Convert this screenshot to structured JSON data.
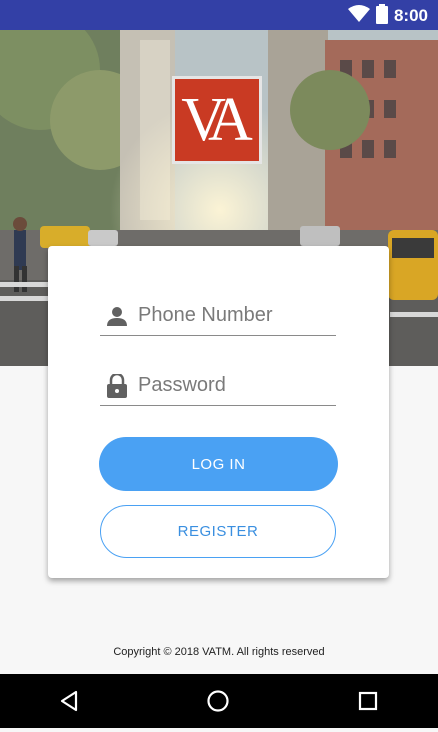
{
  "status_bar": {
    "time": "8:00",
    "icons": [
      "wifi-icon",
      "battery-icon"
    ]
  },
  "logo": {
    "text": "VA",
    "color": "#c93a23"
  },
  "form": {
    "phone": {
      "placeholder": "Phone Number",
      "value": "",
      "icon": "person-icon"
    },
    "password": {
      "placeholder": "Password",
      "value": "",
      "icon": "lock-icon"
    },
    "login_label": "LOG IN",
    "register_label": "REGISTER"
  },
  "footer": {
    "copyright": "Copyright © 2018  VATM. All rights reserved"
  },
  "nav_bar": {
    "buttons": [
      "back-icon",
      "home-icon",
      "recents-icon"
    ]
  },
  "colors": {
    "status_bar": "#3340a6",
    "accent": "#4aa1f3"
  }
}
